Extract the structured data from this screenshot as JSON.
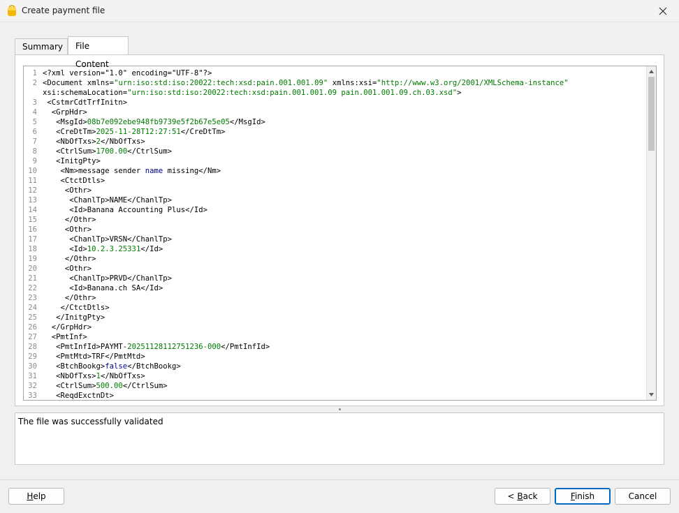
{
  "window": {
    "title": "Create payment file"
  },
  "tabs": [
    {
      "label": "Summary"
    },
    {
      "label": "File Content"
    }
  ],
  "code_lines": [
    {
      "n": "1",
      "parts": [
        [
          "t",
          "<?xml version=\"1.0\" encoding=\"UTF-8\"?>"
        ]
      ]
    },
    {
      "n": "2",
      "parts": [
        [
          "t",
          "<Document xmlns="
        ],
        [
          "s",
          "\"urn:iso:std:iso:20022:tech:xsd:pain.001.001.09\""
        ],
        [
          "t",
          " xmlns:xsi="
        ],
        [
          "s",
          "\"http://www.w3.org/2001/XMLSchema-instance\""
        ]
      ]
    },
    {
      "n": "",
      "parts": [
        [
          "t",
          "xsi:schemaLocation="
        ],
        [
          "s",
          "\"urn:iso:std:iso:20022:tech:xsd:pain.001.001.09 pain.001.001.09.ch.03.xsd\""
        ],
        [
          "t",
          ">"
        ]
      ]
    },
    {
      "n": "3",
      "parts": [
        [
          "t",
          " <CstmrCdtTrfInitn>"
        ]
      ]
    },
    {
      "n": "4",
      "parts": [
        [
          "t",
          "  <GrpHdr>"
        ]
      ]
    },
    {
      "n": "5",
      "parts": [
        [
          "t",
          "   <MsgId>"
        ],
        [
          "s",
          "08b7e092ebe948fb9739e5f2b67e5e05"
        ],
        [
          "t",
          "</MsgId>"
        ]
      ]
    },
    {
      "n": "6",
      "parts": [
        [
          "t",
          "   <CreDtTm>"
        ],
        [
          "s",
          "2025-11-28T12:27:51"
        ],
        [
          "t",
          "</CreDtTm>"
        ]
      ]
    },
    {
      "n": "7",
      "parts": [
        [
          "t",
          "   <NbOfTxs>"
        ],
        [
          "s",
          "2"
        ],
        [
          "t",
          "</NbOfTxs>"
        ]
      ]
    },
    {
      "n": "8",
      "parts": [
        [
          "t",
          "   <CtrlSum>"
        ],
        [
          "s",
          "1700.00"
        ],
        [
          "t",
          "</CtrlSum>"
        ]
      ]
    },
    {
      "n": "9",
      "parts": [
        [
          "t",
          "   <InitgPty>"
        ]
      ]
    },
    {
      "n": "10",
      "parts": [
        [
          "t",
          "    <Nm>message sender "
        ],
        [
          "k",
          "name"
        ],
        [
          "t",
          " missing</Nm>"
        ]
      ]
    },
    {
      "n": "11",
      "parts": [
        [
          "t",
          "    <CtctDtls>"
        ]
      ]
    },
    {
      "n": "12",
      "parts": [
        [
          "t",
          "     <Othr>"
        ]
      ]
    },
    {
      "n": "13",
      "parts": [
        [
          "t",
          "      <ChanlTp>NAME</ChanlTp>"
        ]
      ]
    },
    {
      "n": "14",
      "parts": [
        [
          "t",
          "      <Id>Banana Accounting Plus</Id>"
        ]
      ]
    },
    {
      "n": "15",
      "parts": [
        [
          "t",
          "     </Othr>"
        ]
      ]
    },
    {
      "n": "16",
      "parts": [
        [
          "t",
          "     <Othr>"
        ]
      ]
    },
    {
      "n": "17",
      "parts": [
        [
          "t",
          "      <ChanlTp>VRSN</ChanlTp>"
        ]
      ]
    },
    {
      "n": "18",
      "parts": [
        [
          "t",
          "      <Id>"
        ],
        [
          "s",
          "10.2.3.25331"
        ],
        [
          "t",
          "</Id>"
        ]
      ]
    },
    {
      "n": "19",
      "parts": [
        [
          "t",
          "     </Othr>"
        ]
      ]
    },
    {
      "n": "20",
      "parts": [
        [
          "t",
          "     <Othr>"
        ]
      ]
    },
    {
      "n": "21",
      "parts": [
        [
          "t",
          "      <ChanlTp>PRVD</ChanlTp>"
        ]
      ]
    },
    {
      "n": "22",
      "parts": [
        [
          "t",
          "      <Id>Banana.ch SA</Id>"
        ]
      ]
    },
    {
      "n": "23",
      "parts": [
        [
          "t",
          "     </Othr>"
        ]
      ]
    },
    {
      "n": "24",
      "parts": [
        [
          "t",
          "    </CtctDtls>"
        ]
      ]
    },
    {
      "n": "25",
      "parts": [
        [
          "t",
          "   </InitgPty>"
        ]
      ]
    },
    {
      "n": "26",
      "parts": [
        [
          "t",
          "  </GrpHdr>"
        ]
      ]
    },
    {
      "n": "27",
      "parts": [
        [
          "t",
          "  <PmtInf>"
        ]
      ]
    },
    {
      "n": "28",
      "parts": [
        [
          "t",
          "   <PmtInfId>PAYMT-"
        ],
        [
          "s",
          "20251128112751236-000"
        ],
        [
          "t",
          "</PmtInfId>"
        ]
      ]
    },
    {
      "n": "29",
      "parts": [
        [
          "t",
          "   <PmtMtd>TRF</PmtMtd>"
        ]
      ]
    },
    {
      "n": "30",
      "parts": [
        [
          "t",
          "   <BtchBookg>"
        ],
        [
          "k",
          "false"
        ],
        [
          "t",
          "</BtchBookg>"
        ]
      ]
    },
    {
      "n": "31",
      "parts": [
        [
          "t",
          "   <NbOfTxs>"
        ],
        [
          "s",
          "1"
        ],
        [
          "t",
          "</NbOfTxs>"
        ]
      ]
    },
    {
      "n": "32",
      "parts": [
        [
          "t",
          "   <CtrlSum>"
        ],
        [
          "s",
          "500.00"
        ],
        [
          "t",
          "</CtrlSum>"
        ]
      ]
    },
    {
      "n": "33",
      "parts": [
        [
          "t",
          "   <ReqdExctnDt>"
        ]
      ]
    }
  ],
  "status": {
    "message": "The file was successfully validated"
  },
  "buttons": {
    "help": {
      "mnemonic": "H",
      "rest": "elp"
    },
    "back": {
      "prefix": "< ",
      "mnemonic": "B",
      "rest": "ack"
    },
    "finish": {
      "mnemonic": "F",
      "rest": "inish"
    },
    "cancel": {
      "label": "Cancel"
    }
  },
  "colors": {
    "string": "#007a00",
    "keyword": "#00008b",
    "accent": "#0067c0",
    "app_icon": "#f5b800"
  },
  "icons": {
    "app": "banana-app-icon",
    "close": "close-icon",
    "scroll_up": "arrow-up-icon",
    "scroll_down": "arrow-down-icon"
  }
}
